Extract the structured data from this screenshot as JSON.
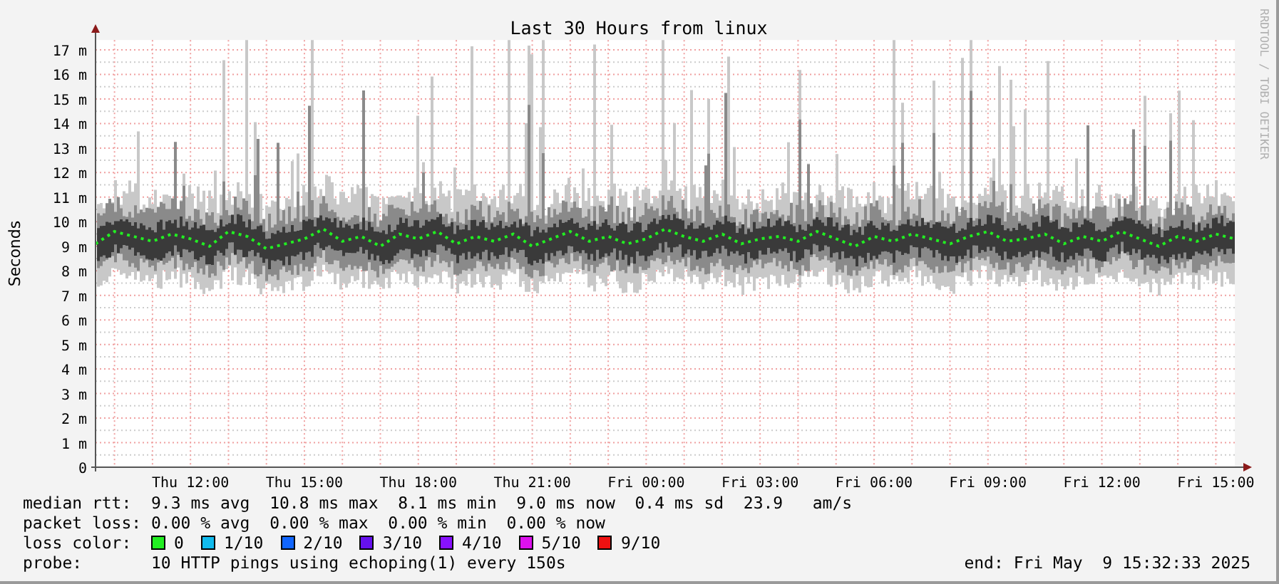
{
  "graph": {
    "title": "Last 30 Hours from linux",
    "credit": "RRDTOOL / TOBI OETIKER",
    "chart_data": {
      "type": "line",
      "ylabel": "Seconds",
      "categories": [
        null,
        null,
        null,
        null,
        null,
        "Thu 12:00",
        null,
        null,
        null,
        null,
        null,
        "Thu 15:00",
        null,
        null,
        null,
        null,
        null,
        "Thu 18:00",
        null,
        null,
        null,
        null,
        null,
        "Thu 21:00",
        null,
        null,
        null,
        null,
        null,
        "Fri 00:00",
        null,
        null,
        null,
        null,
        null,
        "Fri 03:00",
        null,
        null,
        null,
        null,
        null,
        "Fri 06:00",
        null,
        null,
        null,
        null,
        null,
        "Fri 09:00",
        null,
        null,
        null,
        null,
        null,
        "Fri 12:00",
        null,
        null,
        null,
        null,
        null,
        "Fri 15:00",
        null
      ],
      "series": [
        {
          "name": "median rtt:",
          "color": "#22ee22",
          "line_style": "dotted",
          "values": [
            9.1,
            9.6,
            9.4,
            9.2,
            9.5,
            9.3,
            9.0,
            9.6,
            9.4,
            8.9,
            9.1,
            9.3,
            9.7,
            9.2,
            9.4,
            9.0,
            9.5,
            9.3,
            9.6,
            9.1,
            9.4,
            9.2,
            9.5,
            9.0,
            9.3,
            9.6,
            9.2,
            9.4,
            9.1,
            9.3,
            9.7,
            9.4,
            9.2,
            9.5,
            9.1,
            9.3,
            9.4,
            9.2,
            9.6,
            9.3,
            9.0,
            9.4,
            9.2,
            9.5,
            9.3,
            9.1,
            9.4,
            9.6,
            9.2,
            9.3,
            9.5,
            9.1,
            9.4,
            9.2,
            9.6,
            9.3,
            9.0,
            9.4,
            9.2,
            9.5,
            9.3
          ]
        }
      ],
      "ylim": [
        0,
        17.4
      ],
      "grid": true,
      "yticks": [
        {
          "value": 0,
          "label": "0"
        },
        {
          "value": 1,
          "label": "1 m"
        },
        {
          "value": 2,
          "label": "2 m"
        },
        {
          "value": 3,
          "label": "3 m"
        },
        {
          "value": 4,
          "label": "4 m"
        },
        {
          "value": 5,
          "label": "5 m"
        },
        {
          "value": 6,
          "label": "6 m"
        },
        {
          "value": 7,
          "label": "7 m"
        },
        {
          "value": 8,
          "label": "8 m"
        },
        {
          "value": 9,
          "label": "9 m"
        },
        {
          "value": 10,
          "label": "10 m"
        },
        {
          "value": 11,
          "label": "11 m"
        },
        {
          "value": 12,
          "label": "12 m"
        },
        {
          "value": 13,
          "label": "13 m"
        },
        {
          "value": 14,
          "label": "14 m"
        },
        {
          "value": 15,
          "label": "15 m"
        },
        {
          "value": 16,
          "label": "16 m"
        },
        {
          "value": 17,
          "label": "17 m"
        }
      ]
    }
  },
  "legend": {
    "median_rtt": {
      "value": "9.3 ms avg  10.8 ms max  8.1 ms min  9.0 ms now  0.4 ms sd  23.9   am/s"
    },
    "packet_loss": {
      "label": "packet loss:",
      "value": "0.00 % avg  0.00 % max  0.00 % min  0.00 % now"
    },
    "loss_color": {
      "label": "loss color:",
      "items": [
        {
          "color": "#22ee22",
          "label": "0"
        },
        {
          "color": "#11bbee",
          "label": "1/10"
        },
        {
          "color": "#1166ff",
          "label": "2/10"
        },
        {
          "color": "#6611ee",
          "label": "3/10"
        },
        {
          "color": "#8811ff",
          "label": "4/10"
        },
        {
          "color": "#dd11ee",
          "label": "5/10"
        },
        {
          "color": "#ee1111",
          "label": "9/10"
        }
      ]
    },
    "probe": {
      "label": "probe:",
      "value": "10 HTTP pings using echoping(1) every 150s"
    },
    "end": "end: Fri May  9 15:32:33 2025"
  }
}
